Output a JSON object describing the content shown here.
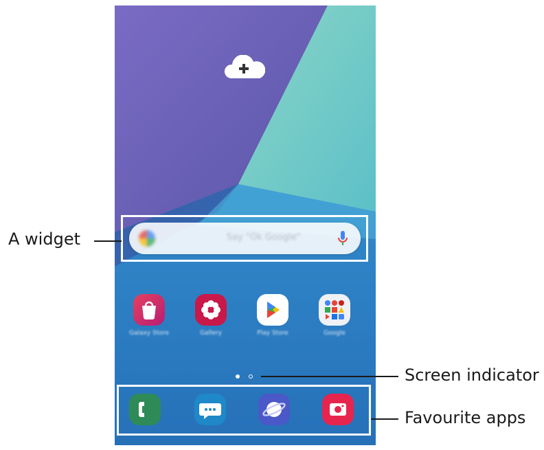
{
  "callouts": {
    "widget": "A widget",
    "screen_indicator": "Screen indicator",
    "favourite_apps": "Favourite apps"
  },
  "wallpaper": {
    "colors": [
      "#6a5fb5",
      "#7d6bc0",
      "#69c8c2",
      "#2f7fc2",
      "#3b94d4"
    ],
    "top_icon": "cloud-plus-icon"
  },
  "widget": {
    "logo_icon": "google-g-icon",
    "hint": "Say \"Ok Google\"",
    "mic_icon": "mic-icon"
  },
  "apps": [
    {
      "name": "Galaxy Store",
      "icon": "shopping-bag-icon",
      "color": "#e4415f"
    },
    {
      "name": "Gallery",
      "icon": "flower-icon",
      "color": "#c9184a"
    },
    {
      "name": "Play Store",
      "icon": "play-triangle-icon",
      "color": "#ffffff"
    },
    {
      "name": "Google",
      "icon": "app-folder-icon",
      "color": "#eef1f5"
    }
  ],
  "screen_indicator": {
    "icons": [
      "home-dot-icon",
      "page-dot-icon"
    ]
  },
  "dock": [
    {
      "name": "Phone",
      "icon": "phone-icon",
      "color": "#2e8b57"
    },
    {
      "name": "Messages",
      "icon": "chat-bubble-icon",
      "color": "#1e88c9"
    },
    {
      "name": "Internet",
      "icon": "planet-icon",
      "color": "#4a58c8"
    },
    {
      "name": "Camera",
      "icon": "camera-icon",
      "color": "#e6244d"
    }
  ]
}
